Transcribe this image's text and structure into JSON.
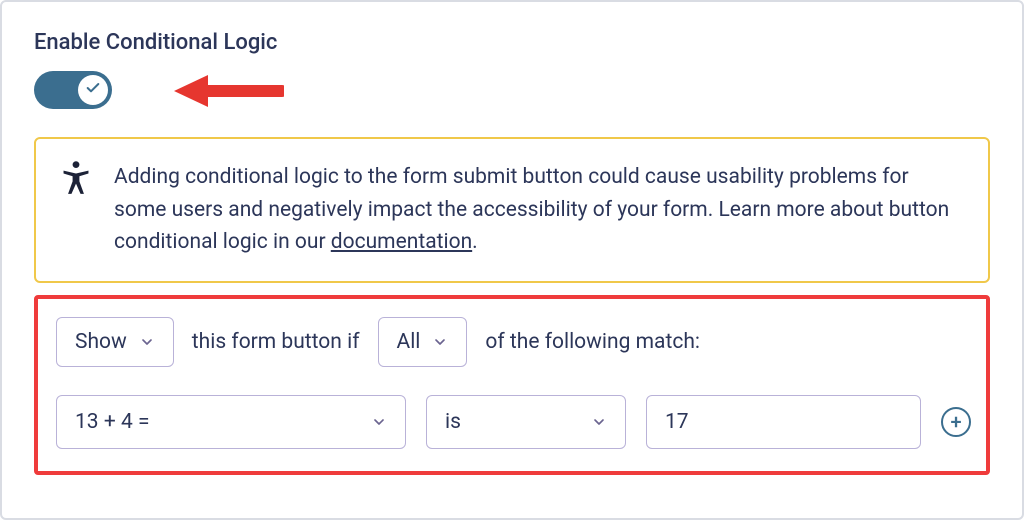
{
  "section": {
    "title": "Enable Conditional Logic",
    "toggle_on": true
  },
  "notice": {
    "text_before_link": "Adding conditional logic to the form submit button could cause usability problems for some users and negatively impact the accessibility of your form. Learn more about button conditional logic in our ",
    "link_text": "documentation",
    "text_after_link": "."
  },
  "rules": {
    "action_select": "Show",
    "text_mid1": "this form button if",
    "match_select": "All",
    "text_mid2": "of the following match:",
    "row": {
      "field": "13 + 4 =",
      "operator": "is",
      "value": "17"
    },
    "add_label": "+"
  },
  "colors": {
    "accent": "#3b6e8f",
    "warning_border": "#f0c84a",
    "highlight_border": "#ef3b3b",
    "text": "#2c3659",
    "control_border": "#b9b2d8"
  }
}
